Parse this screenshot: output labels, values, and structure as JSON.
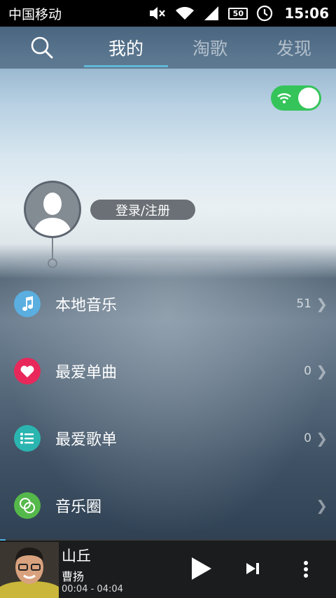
{
  "status_bar": {
    "carrier": "中国移动",
    "battery": "50",
    "time": "15:06"
  },
  "nav": {
    "tabs": [
      {
        "label": "我的",
        "active": true
      },
      {
        "label": "淘歌",
        "active": false
      },
      {
        "label": "发现",
        "active": false
      }
    ]
  },
  "profile": {
    "login_label": "登录/注册"
  },
  "menu": {
    "items": [
      {
        "label": "本地音乐",
        "count": "51",
        "icon": "music-note-icon",
        "color": "#5aaee0"
      },
      {
        "label": "最爱单曲",
        "count": "0",
        "icon": "heart-icon",
        "color": "#e8285a"
      },
      {
        "label": "最爱歌单",
        "count": "0",
        "icon": "list-icon",
        "color": "#2bb5b0"
      },
      {
        "label": "音乐圈",
        "count": "",
        "icon": "circles-icon",
        "color": "#55b84a"
      }
    ]
  },
  "player": {
    "song": "山丘",
    "artist": "曹扬",
    "time": "00:04 - 04:04",
    "progress": 0.017
  },
  "colors": {
    "accent": "#5fb9d6",
    "toggle_on": "#35c45a"
  }
}
